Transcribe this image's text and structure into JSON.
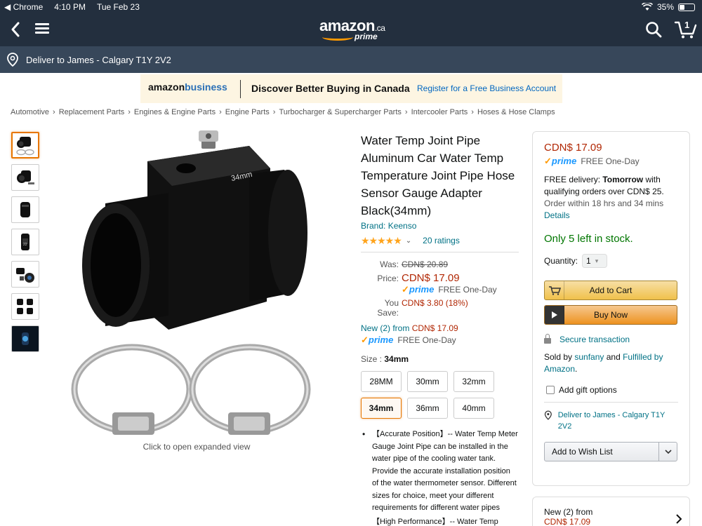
{
  "status": {
    "app": "◀ Chrome",
    "time": "4:10 PM",
    "date": "Tue Feb 23",
    "battery": "35%",
    "battery_level": 0.35
  },
  "nav": {
    "logo_text": "amazon",
    "logo_tld": ".ca",
    "logo_prime": "prime",
    "cart_count": "1"
  },
  "deliver": {
    "text": "Deliver to James - Calgary T1Y 2V2"
  },
  "business": {
    "logo_a": "amazon",
    "logo_b": "business",
    "headline": "Discover Better Buying in Canada",
    "link": "Register for a Free Business Account"
  },
  "breadcrumb": [
    "Automotive",
    "Replacement Parts",
    "Engines & Engine Parts",
    "Engine Parts",
    "Turbocharger & Supercharger Parts",
    "Intercooler Parts",
    "Hoses & Hose Clamps"
  ],
  "gallery": {
    "hint": "Click to open expanded view",
    "image_label": "34mm",
    "thumb_count": 7
  },
  "product": {
    "title": "Water Temp Joint Pipe Aluminum Car Water Temp Temperature Joint Pipe Hose Sensor Gauge Adapter Black(34mm)",
    "brand": "Brand: Keenso",
    "stars": "★★★★★",
    "rating_value": 4.5,
    "ratings_count": "20 ratings",
    "was_label": "Was:",
    "was_price": "CDN$ 20.89",
    "price_label": "Price:",
    "price": "CDN$ 17.09",
    "prime_label": "prime",
    "one_day": "FREE One-Day",
    "save_label": "You Save:",
    "save": "CDN$ 3.80 (18%)",
    "new_from_a": "New (2) from ",
    "new_from_price": "CDN$ 17.09",
    "size_label": "Size : ",
    "size_value": "34mm",
    "sizes": [
      "28MM",
      "30mm",
      "32mm",
      "34mm",
      "36mm",
      "40mm"
    ],
    "selected_size": "34mm",
    "bullet": "【Accurate Position】-- Water Temp Meter Gauge Joint Pipe can be installed in the water pipe of the cooling water tank. Provide the accurate installation position of the water thermometer sensor. Different sizes for choice, meet your different requirements for different water pipes",
    "bullet_next": "【High Performance】-- Water Temp"
  },
  "buybox": {
    "price": "CDN$ 17.09",
    "prime_label": "prime",
    "one_day": "FREE One-Day",
    "delivery_a": "FREE delivery: ",
    "delivery_b": "Tomorrow",
    "delivery_c": " with qualifying orders over CDN$ 25.",
    "order_within": "Order within 18 hrs and 34 mins",
    "details": "Details",
    "stock": "Only 5 left in stock.",
    "qty_label": "Quantity:",
    "qty_value": "1",
    "add_to_cart": "Add to Cart",
    "buy_now": "Buy Now",
    "secure": "Secure transaction",
    "sold_a": "Sold by ",
    "seller": "sunfany",
    "sold_b": " and ",
    "fulfilled": "Fulfilled by Amazon",
    "period": ".",
    "gift": "Add gift options",
    "deliver_to": "Deliver to James - Calgary T1Y 2V2",
    "wishlist": "Add to Wish List"
  },
  "newbox": {
    "label": "New (2) from",
    "price": "CDN$ 17.09"
  },
  "colors": {
    "nav_bg": "#232f3e",
    "deliver_bg": "#37475a",
    "price_red": "#b12704",
    "link_teal": "#007185",
    "stock_green": "#007600",
    "prime_blue": "#1a98ff",
    "accent_orange": "#ff9900"
  }
}
